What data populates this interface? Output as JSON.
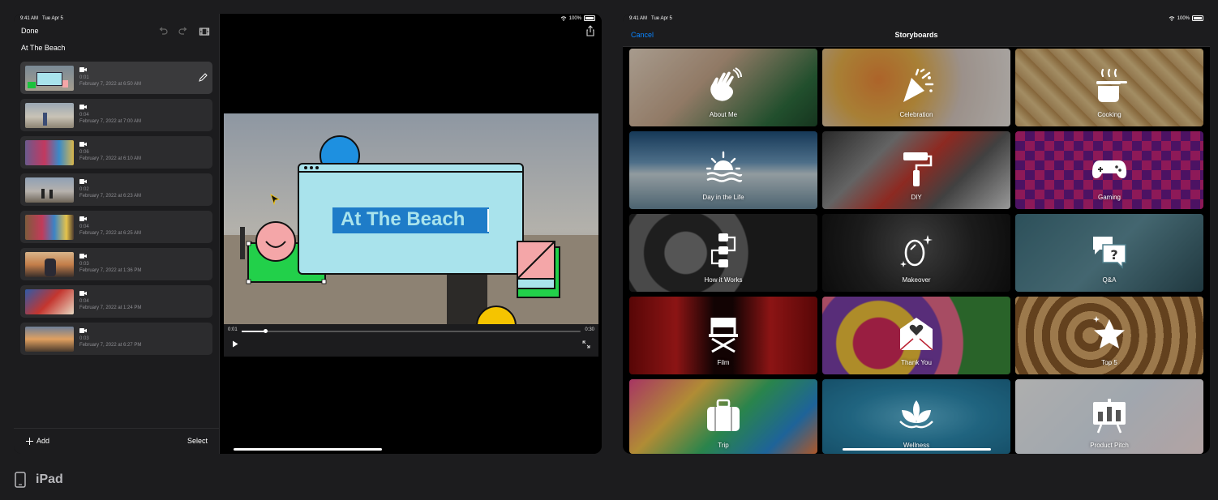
{
  "status": {
    "time": "9:41 AM",
    "date": "Tue Apr 5",
    "battery": "100%"
  },
  "editor": {
    "done_label": "Done",
    "project_title": "At The Beach",
    "add_label": "Add",
    "select_label": "Select",
    "clips": [
      {
        "duration": "0:01",
        "date": "February 7, 2022 at 6:50 AM"
      },
      {
        "duration": "0:04",
        "date": "February 7, 2022 at 7:00 AM"
      },
      {
        "duration": "0:06",
        "date": "February 7, 2022 at 6:10 AM"
      },
      {
        "duration": "0:02",
        "date": "February 7, 2022 at 6:23 AM"
      },
      {
        "duration": "0:04",
        "date": "February 7, 2022 at 6:25 AM"
      },
      {
        "duration": "0:03",
        "date": "February 7, 2022 at 1:36 PM"
      },
      {
        "duration": "0:04",
        "date": "February 7, 2022 at 1:24 PM"
      },
      {
        "duration": "0:03",
        "date": "February 7, 2022 at 6:27 PM"
      }
    ],
    "title_card_text": "At The Beach",
    "time_current": "0:01",
    "time_total": "0:30",
    "playback_progress": 0.07
  },
  "storyboards": {
    "cancel_label": "Cancel",
    "title": "Storyboards",
    "accent": "#0a84ff",
    "tiles": [
      {
        "label": "About Me",
        "icon": "hand-wave-icon"
      },
      {
        "label": "Celebration",
        "icon": "party-popper-icon"
      },
      {
        "label": "Cooking",
        "icon": "cooking-pot-icon"
      },
      {
        "label": "Day in the Life",
        "icon": "sunrise-icon"
      },
      {
        "label": "DIY",
        "icon": "paint-roller-icon"
      },
      {
        "label": "Gaming",
        "icon": "gamecontroller-icon"
      },
      {
        "label": "How it Works",
        "icon": "flowchart-icon"
      },
      {
        "label": "Makeover",
        "icon": "mirror-sparkle-icon"
      },
      {
        "label": "Q&A",
        "icon": "question-bubbles-icon"
      },
      {
        "label": "Film",
        "icon": "directors-chair-icon"
      },
      {
        "label": "Thank You",
        "icon": "heart-envelope-icon"
      },
      {
        "label": "Top 5",
        "icon": "star-sparkle-icon"
      },
      {
        "label": "Trip",
        "icon": "suitcase-icon"
      },
      {
        "label": "Wellness",
        "icon": "lotus-icon"
      },
      {
        "label": "Product Pitch",
        "icon": "presentation-chart-icon"
      }
    ]
  },
  "footer": {
    "device_name": "iPad"
  }
}
